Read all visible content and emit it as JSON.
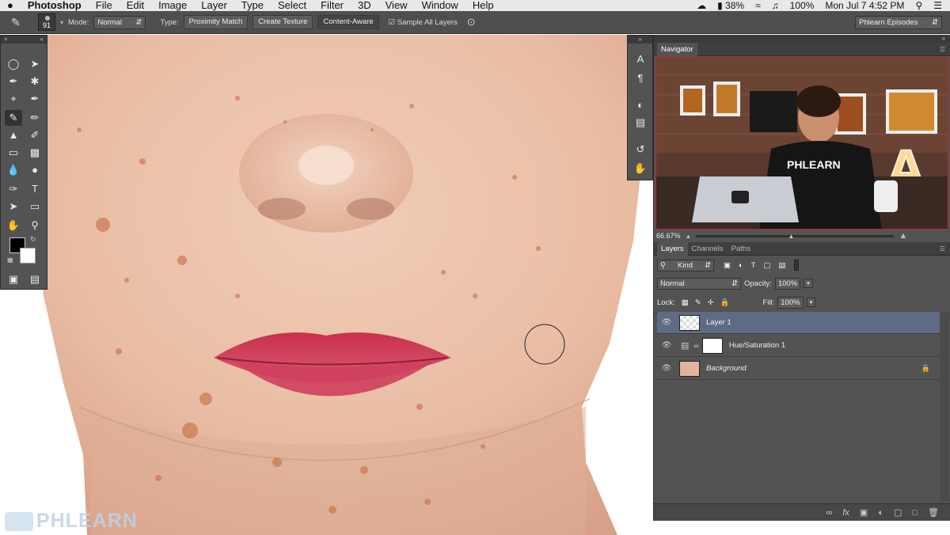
{
  "menubar": {
    "apple": "",
    "app": "Photoshop",
    "items": [
      "File",
      "Edit",
      "Image",
      "Layer",
      "Type",
      "Select",
      "Filter",
      "3D",
      "View",
      "Window",
      "Help"
    ],
    "battery": "38%",
    "volume": "100%",
    "datetime": "Mon Jul 7  4:52 PM"
  },
  "options": {
    "brush_size": "91",
    "mode_label": "Mode:",
    "mode_value": "Normal",
    "type_label": "Type:",
    "type_buttons": [
      "Proximity Match",
      "Create Texture",
      "Content-Aware"
    ],
    "sample_all_layers": "Sample All Layers",
    "workspace": "Phlearn Episodes"
  },
  "navigator": {
    "title": "Navigator",
    "zoom": "66.67%",
    "shirt_text": "PHLEARN",
    "sign_letter": "A"
  },
  "layers_panel": {
    "tabs": [
      "Layers",
      "Channels",
      "Paths"
    ],
    "kind_filter": "Kind",
    "blend_mode": "Normal",
    "opacity_label": "Opacity:",
    "opacity_value": "100%",
    "lock_label": "Lock:",
    "fill_label": "Fill:",
    "fill_value": "100%",
    "layers": [
      {
        "name": "Layer 1"
      },
      {
        "name": "Hue/Saturation 1"
      },
      {
        "name": "Background"
      }
    ]
  },
  "watermark": "PHLEARN",
  "colors": {
    "panel_bg": "#535353",
    "selected_layer": "#5f6b85",
    "lip_red": "#c9304a",
    "skin": "#efc9b4"
  }
}
